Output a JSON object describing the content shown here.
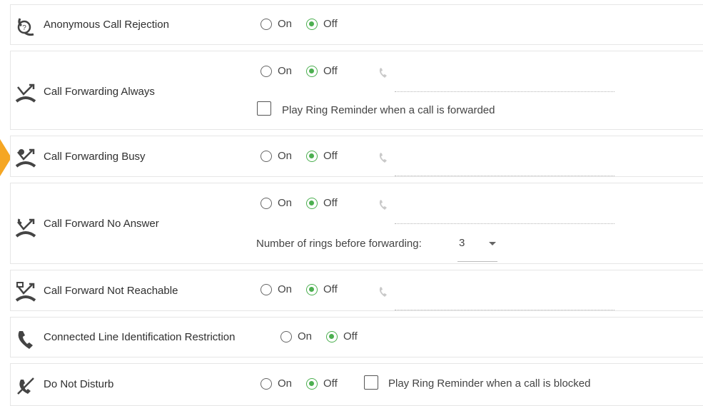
{
  "options": {
    "on": "On",
    "off": "Off"
  },
  "rows": [
    {
      "label": "Anonymous Call Rejection",
      "icon": "anonymous-call-icon",
      "state": "Off"
    },
    {
      "label": "Call Forwarding Always",
      "icon": "call-forward-icon",
      "state": "Off",
      "checkbox_label": "Play Ring Reminder when a call is forwarded"
    },
    {
      "label": "Call Forwarding Busy",
      "icon": "call-forward-busy-icon",
      "state": "Off"
    },
    {
      "label": "Call Forward No Answer",
      "icon": "call-forward-no-answer-icon",
      "state": "Off",
      "rings_label": "Number of rings before forwarding:",
      "rings_value": "3"
    },
    {
      "label": "Call Forward Not Reachable",
      "icon": "call-forward-not-reachable-icon",
      "state": "Off"
    },
    {
      "label": "Connected Line Identification Restriction",
      "icon": "phone-handset-icon",
      "state": "Off"
    },
    {
      "label": "Do Not Disturb",
      "icon": "do-not-disturb-icon",
      "state": "Off",
      "checkbox_label": "Play Ring Reminder when a call is blocked"
    }
  ],
  "colors": {
    "accent": "#4caf50",
    "marker": "#f5a623",
    "border": "#e6e6e6"
  }
}
